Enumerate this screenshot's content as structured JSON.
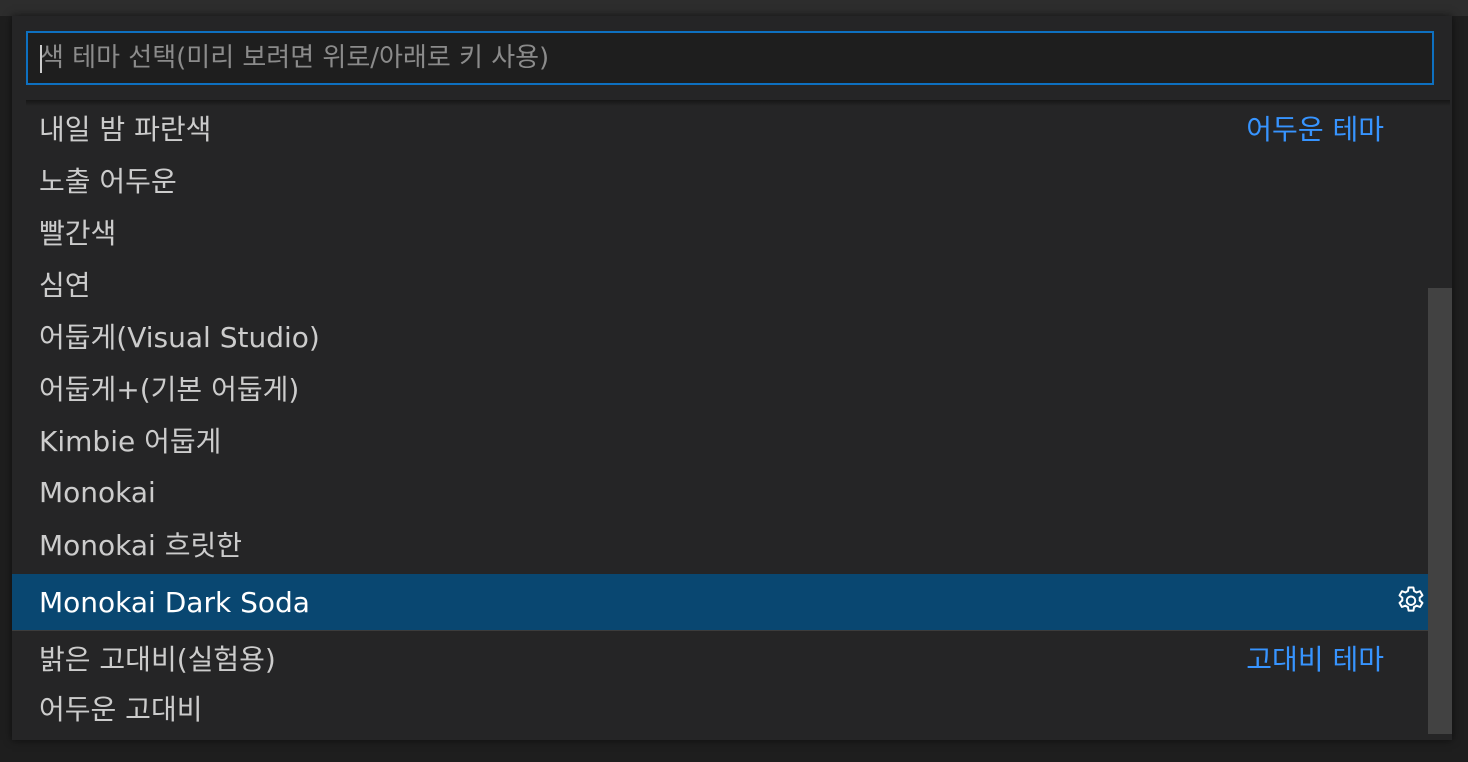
{
  "quickpick": {
    "placeholder": "색 테마 선택(미리 보려면 위로/아래로 키 사용)",
    "value": "",
    "items": [
      {
        "label": "내일 밤 파란색",
        "separator": "어두운 테마"
      },
      {
        "label": "노출 어두운"
      },
      {
        "label": "빨간색"
      },
      {
        "label": "심연"
      },
      {
        "label": "어둡게(Visual Studio)"
      },
      {
        "label": "어둡게+(기본 어둡게)"
      },
      {
        "label": "Kimbie 어둡게"
      },
      {
        "label": "Monokai"
      },
      {
        "label": "Monokai 흐릿한"
      },
      {
        "label": "Monokai Dark Soda",
        "selected": true,
        "icon": "gear-icon"
      },
      {
        "label": "밝은 고대비(실험용)",
        "separator": "고대비 테마"
      },
      {
        "label": "어두운 고대비"
      }
    ]
  },
  "colors": {
    "selection": "#094771",
    "focus_border": "#0e70c0",
    "separator_label": "#3794ff",
    "foreground": "#cccccc"
  }
}
